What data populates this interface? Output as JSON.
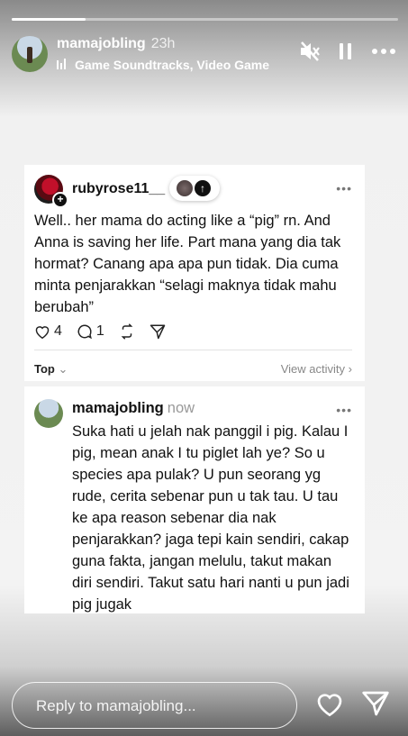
{
  "story": {
    "progress_fraction": 0.19,
    "username": "mamajobling",
    "time_ago": "23h",
    "music": "Game Soundtracks, Video Game",
    "icons": [
      "mute-icon",
      "pause-icon",
      "more-icon"
    ]
  },
  "thread_post": {
    "username": "rubyrose11__",
    "more": "•••",
    "text": "Well.. her mama do acting like a “pig” rn. And Anna is saving her life. Part mana yang dia tak hormat? Canang apa apa pun tidak. Dia cuma minta penjarakkan “selagi maknya tidak mahu berubah”",
    "likes": "4",
    "comments": "1",
    "sort_label": "Top",
    "view_activity": "View activity"
  },
  "reply_post": {
    "username": "mamajobling",
    "time": "now",
    "more": "•••",
    "text": "Suka hati u jelah nak panggil i pig. Kalau I pig, mean anak I tu piglet lah ye? So u species apa pulak? U pun seorang yg rude, cerita sebenar pun u tak tau. U tau ke apa reason sebenar dia nak penjarakkan? jaga tepi kain sendiri, cakap guna fakta, jangan melulu, takut makan diri sendiri. Takut satu hari nanti u pun jadi pig jugak"
  },
  "footer": {
    "reply_placeholder": "Reply to mamajobling...",
    "icons": [
      "heart-icon",
      "send-icon"
    ]
  }
}
